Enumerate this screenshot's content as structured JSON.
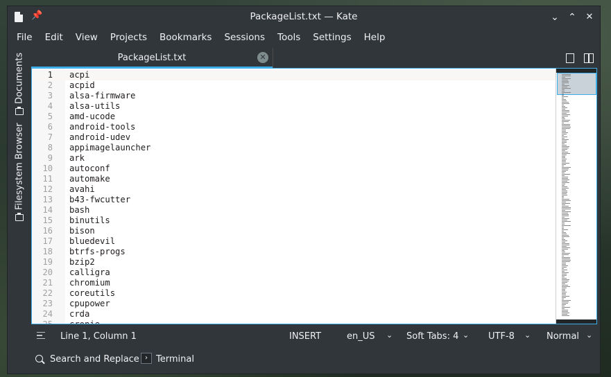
{
  "window": {
    "title": "PackageList.txt — Kate",
    "title_icons": [
      "document-icon",
      "pin-icon"
    ],
    "controls": [
      "minimize-icon",
      "maximize-icon",
      "close-icon"
    ]
  },
  "menu": [
    "File",
    "Edit",
    "View",
    "Projects",
    "Bookmarks",
    "Sessions",
    "Tools",
    "Settings",
    "Help"
  ],
  "sidebar": {
    "documents": "Documents",
    "filesystem": "Filesystem Browser"
  },
  "tab": {
    "label": "PackageList.txt"
  },
  "editor": {
    "current_line": 1,
    "lines": [
      "acpi",
      "acpid",
      "alsa-firmware",
      "alsa-utils",
      "amd-ucode",
      "android-tools",
      "android-udev",
      "appimagelauncher",
      "ark",
      "autoconf",
      "automake",
      "avahi",
      "b43-fwcutter",
      "bash",
      "binutils",
      "bison",
      "bluedevil",
      "btrfs-progs",
      "bzip2",
      "calligra",
      "chromium",
      "coreutils",
      "cpupower",
      "crda",
      "cronie"
    ]
  },
  "status": {
    "position": "Line 1, Column 1",
    "mode": "INSERT",
    "dictionary": "en_US",
    "indent": "Soft Tabs: 4",
    "encoding": "UTF-8",
    "syntax": "Normal"
  },
  "toolbar": {
    "search": "Search and Replace",
    "terminal": "Terminal"
  },
  "colors": {
    "accent": "#3daee9",
    "window_bg": "#31363b",
    "editor_bg": "#ffffff"
  }
}
